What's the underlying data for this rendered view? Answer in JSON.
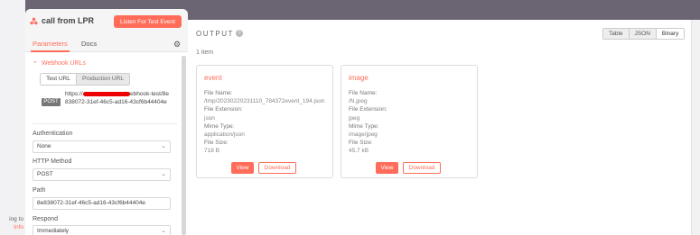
{
  "background": {
    "left_texts": [
      "ing to",
      "Info"
    ]
  },
  "panel": {
    "title": "call from LPR",
    "listen_button": "Listen For Test Event",
    "tabs": [
      "Parameters",
      "Docs"
    ],
    "webhook_section": "Webhook URLs",
    "url_toggle": [
      "Test URL",
      "Production URL"
    ],
    "method": "POST",
    "url": "https://REDACTED/webhook-test/8e838072-31ef-46c5-ad16-43cf6b44404e",
    "url_display_start": "https://",
    "url_display_rest": "/webhook-test/8e838072-31ef-46c5-ad16-43cf6b44404e",
    "fields": {
      "authentication_label": "Authentication",
      "authentication_value": "None",
      "http_method_label": "HTTP Method",
      "http_method_value": "POST",
      "path_label": "Path",
      "path_value": "8e838072-31ef-46c5-ad16-43cf6b44404e",
      "respond_label": "Respond",
      "respond_value": "Immediately"
    }
  },
  "output": {
    "title": "OUTPUT",
    "view_options": [
      "Table",
      "JSON",
      "Binary"
    ],
    "selected_view": "Binary",
    "item_count": "1 item",
    "cards": [
      {
        "title": "event",
        "file_name_label": "File Name:",
        "file_name": "/tmp/20230220231110_784372event_194.json",
        "ext_label": "File Extension:",
        "ext": "json",
        "mime_label": "Mime Type:",
        "mime": "application/json",
        "size_label": "File Size:",
        "size": "718 B",
        "view": "View",
        "download": "Download"
      },
      {
        "title": "image",
        "file_name_label": "File Name:",
        "file_name": "/N.jpeg",
        "ext_label": "File Extension:",
        "ext": "jpeg",
        "mime_label": "Mime Type:",
        "mime": "image/jpeg",
        "size_label": "File Size:",
        "size": "45.7 kB",
        "view": "View",
        "download": "Download"
      }
    ]
  },
  "colors": {
    "accent": "#ff6d5a",
    "backdrop": "#6b6573"
  }
}
